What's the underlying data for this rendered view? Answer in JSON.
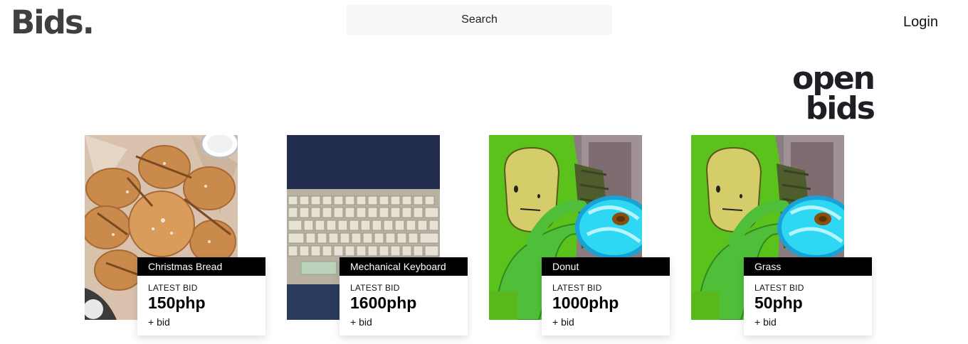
{
  "header": {
    "logo": "Bids.",
    "search_placeholder": "Search",
    "login_label": "Login"
  },
  "hero": {
    "line1": "open",
    "line2": "bids"
  },
  "cards": [
    {
      "title": "Christmas Bread",
      "label": "LATEST BID",
      "price": "150php",
      "action": "+ bid"
    },
    {
      "title": "Mechanical Keyboard",
      "label": "LATEST BID",
      "price": "1600php",
      "action": "+ bid"
    },
    {
      "title": "Donut",
      "label": "LATEST BID",
      "price": "1000php",
      "action": "+ bid"
    },
    {
      "title": "Grass",
      "label": "LATEST BID",
      "price": "50php",
      "action": "+ bid"
    }
  ],
  "colors": {
    "logo": "#3f3f3f",
    "search_bg": "#f6f7f9",
    "card_title_bg": "#000000",
    "hero_text": "#1e1f24"
  }
}
